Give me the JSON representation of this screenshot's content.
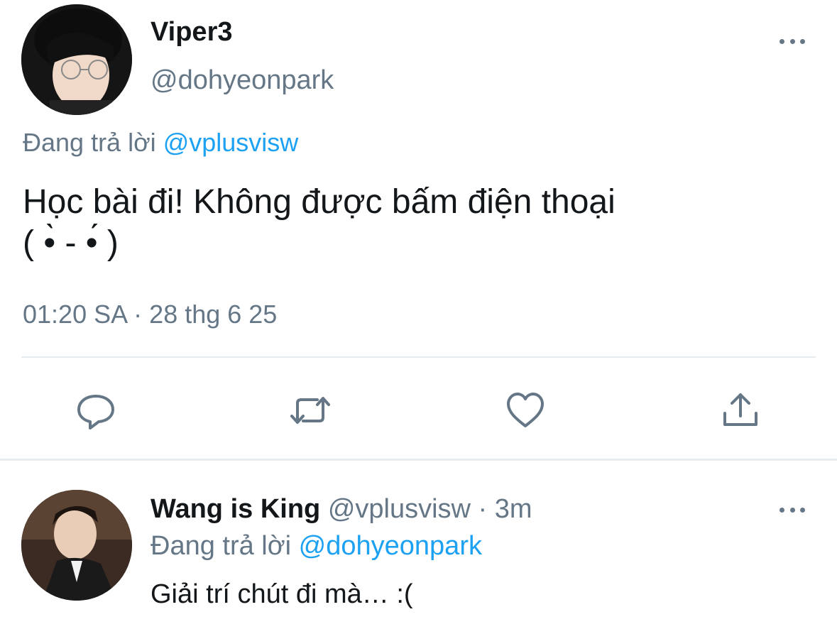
{
  "main_tweet": {
    "display_name": "Viper3",
    "handle": "@dohyeonpark",
    "replying_prefix": "Đang trả lời",
    "replying_to": "@vplusvisw",
    "text_line1": "Học bài đi! Không được bấm điện thoại",
    "text_line2": "( •̀ - •́ )",
    "time": "01:20 SA",
    "separator": "·",
    "date": "28 thg 6 25",
    "more_icon": "more-dots-icon"
  },
  "actions": {
    "reply_icon": "reply-icon",
    "retweet_icon": "retweet-icon",
    "like_icon": "heart-icon",
    "share_icon": "share-icon"
  },
  "reply_tweet": {
    "display_name": "Wang is King",
    "handle": "@vplusvisw",
    "separator": "·",
    "time": "3m",
    "replying_prefix": "Đang trả lời",
    "replying_to": "@dohyeonpark",
    "text": "Giải trí chút đi mà… :(",
    "more_icon": "more-dots-icon"
  },
  "colors": {
    "primary_text": "#14171a",
    "secondary_text": "#657786",
    "link": "#1da1f2",
    "divider": "#e6ecf0"
  }
}
